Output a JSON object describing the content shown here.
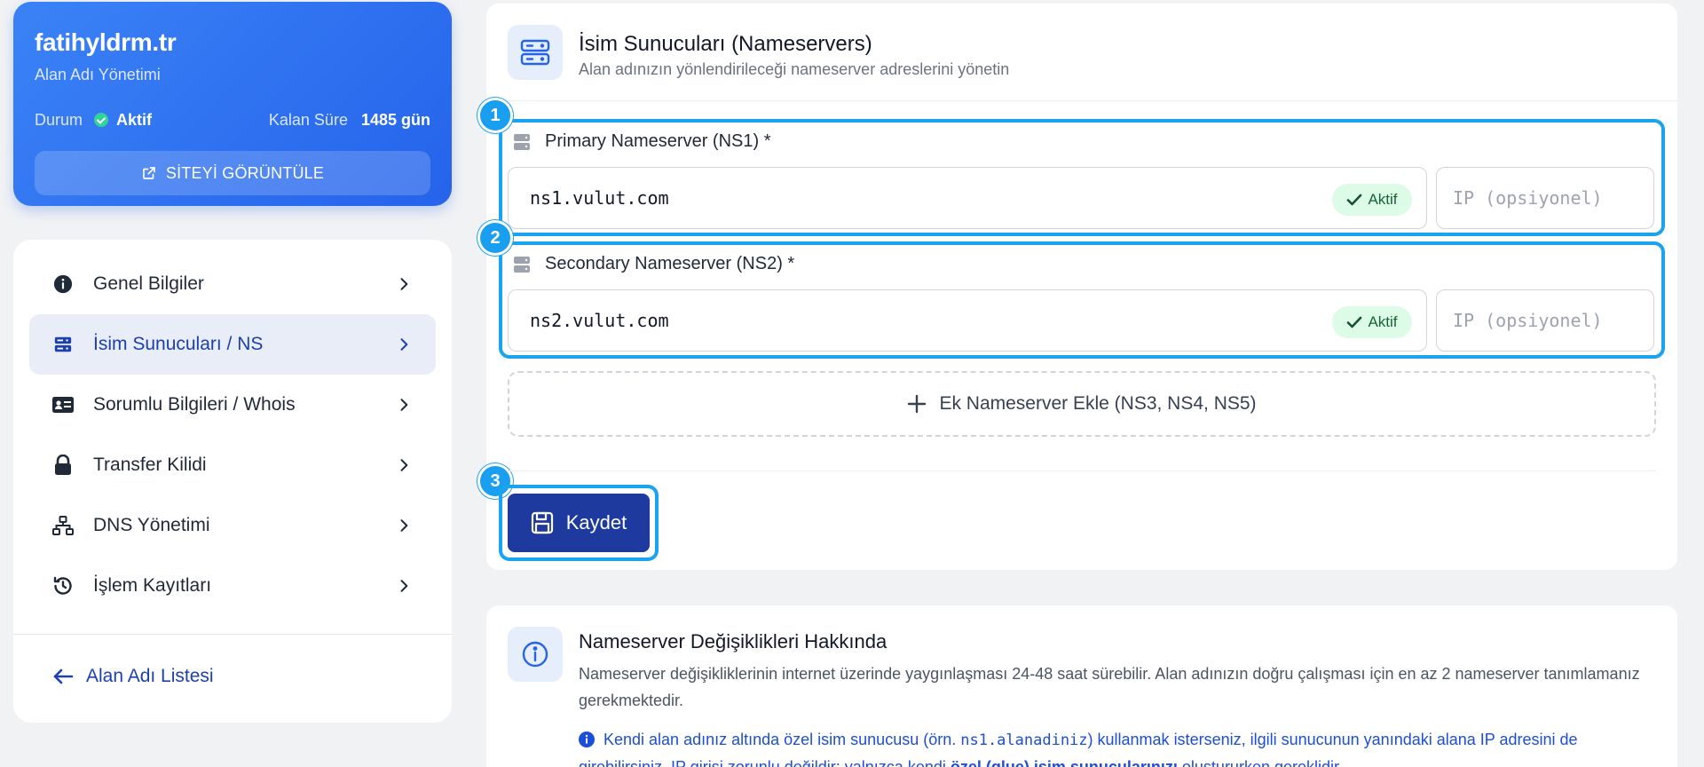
{
  "domain": {
    "name": "fatihyldrm.tr",
    "subtitle": "Alan Adı Yönetimi",
    "status_label": "Durum",
    "status_value": "Aktif",
    "remaining_label": "Kalan Süre",
    "remaining_value": "1485 gün",
    "view_site_label": "SİTEYİ GÖRÜNTÜLE"
  },
  "nav": {
    "items": [
      {
        "label": "Genel Bilgiler",
        "icon": "info-circle-icon"
      },
      {
        "label": "İsim Sunucuları / NS",
        "icon": "server-icon",
        "active": true
      },
      {
        "label": "Sorumlu Bilgileri / Whois",
        "icon": "id-card-icon"
      },
      {
        "label": "Transfer Kilidi",
        "icon": "lock-icon"
      },
      {
        "label": "DNS Yönetimi",
        "icon": "network-icon"
      },
      {
        "label": "İşlem Kayıtları",
        "icon": "history-icon"
      }
    ],
    "back_label": "Alan Adı Listesi"
  },
  "ns_panel": {
    "title": "İsim Sunucuları (Nameservers)",
    "subtitle": "Alan adınızın yönlendirileceği nameserver adreslerini yönetin",
    "ns1": {
      "label": "Primary Nameserver (NS1) *",
      "value": "ns1.vulut.com",
      "badge": "Aktif",
      "ip_placeholder": "IP (opsiyonel)"
    },
    "ns2": {
      "label": "Secondary Nameserver (NS2) *",
      "value": "ns2.vulut.com",
      "badge": "Aktif",
      "ip_placeholder": "IP (opsiyonel)"
    },
    "add_label": "Ek Nameserver Ekle (NS3, NS4, NS5)",
    "save_label": "Kaydet",
    "steps": [
      "1",
      "2",
      "3"
    ]
  },
  "info": {
    "title": "Nameserver Değişiklikleri Hakkında",
    "text": "Nameserver değişikliklerinin internet üzerinde yaygınlaşması 24-48 saat sürebilir. Alan adınızın doğru çalışması için en az 2 nameserver tanımlamanız gerekmektedir.",
    "note_prefix": "Kendi alan adınız altında özel isim sunucusu (örn. ",
    "note_code": "ns1.alanadiniz",
    "note_middle": ") kullanmak isterseniz, ilgili sunucunun yanındaki alana IP adresini de girebilirsiniz. IP girişi zorunlu değildir; yalnızca kendi ",
    "note_bold": "özel (glue) isim sunucularınızı",
    "note_suffix": " oluştururken gereklidir."
  },
  "colors": {
    "accent": "#2563eb",
    "highlight": "#1aa3ee",
    "save": "#1e3a9f",
    "success": "#16a34a"
  }
}
